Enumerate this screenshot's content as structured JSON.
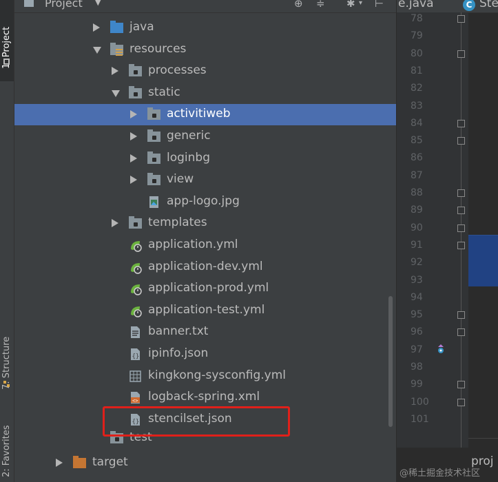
{
  "sidebar": {
    "project_tab": "1: Project",
    "structure_tab": "7: Structure",
    "favorites_tab": "2: Favorites"
  },
  "toolbar": {
    "title": "Project",
    "caret": "▼"
  },
  "tree": [
    {
      "label": "java",
      "indent": 1,
      "expand": "right",
      "icon": "folder-blue-icon"
    },
    {
      "label": "resources",
      "indent": 1,
      "expand": "down",
      "icon": "resources-folder-icon"
    },
    {
      "label": "processes",
      "indent": 2,
      "expand": "right",
      "icon": "folder-icon"
    },
    {
      "label": "static",
      "indent": 2,
      "expand": "down",
      "icon": "folder-icon"
    },
    {
      "label": "activitiweb",
      "indent": 3,
      "expand": "right",
      "icon": "folder-icon",
      "selected": true
    },
    {
      "label": "generic",
      "indent": 3,
      "expand": "right",
      "icon": "folder-icon"
    },
    {
      "label": "loginbg",
      "indent": 3,
      "expand": "right",
      "icon": "folder-icon"
    },
    {
      "label": "view",
      "indent": 3,
      "expand": "right",
      "icon": "folder-icon"
    },
    {
      "label": "app-logo.jpg",
      "indent": 3,
      "expand": "none",
      "icon": "image-file-icon"
    },
    {
      "label": "templates",
      "indent": 2,
      "expand": "right",
      "icon": "folder-icon"
    },
    {
      "label": "application.yml",
      "indent": 2,
      "expand": "none",
      "icon": "spring-config-icon"
    },
    {
      "label": "application-dev.yml",
      "indent": 2,
      "expand": "none",
      "icon": "spring-config-icon"
    },
    {
      "label": "application-prod.yml",
      "indent": 2,
      "expand": "none",
      "icon": "spring-config-icon"
    },
    {
      "label": "application-test.yml",
      "indent": 2,
      "expand": "none",
      "icon": "spring-config-icon"
    },
    {
      "label": "banner.txt",
      "indent": 2,
      "expand": "none",
      "icon": "text-file-icon"
    },
    {
      "label": "ipinfo.json",
      "indent": 2,
      "expand": "none",
      "icon": "json-file-icon"
    },
    {
      "label": "kingkong-sysconfig.yml",
      "indent": 2,
      "expand": "none",
      "icon": "table-file-icon"
    },
    {
      "label": "logback-spring.xml",
      "indent": 2,
      "expand": "none",
      "icon": "xml-file-icon"
    },
    {
      "label": "stencilset.json",
      "indent": 2,
      "expand": "none",
      "icon": "json-file-icon",
      "highlighted": true
    },
    {
      "label": "test",
      "indent": 1,
      "expand": "none",
      "icon": "folder-icon"
    },
    {
      "label": "target",
      "indent": 0,
      "expand": "right",
      "icon": "folder-orange-icon"
    }
  ],
  "editor": {
    "tab1": "e.java",
    "tab2_icon": "C",
    "tab2": "Ste",
    "line_numbers": [
      "78",
      "79",
      "80",
      "81",
      "82",
      "83",
      "84",
      "85",
      "86",
      "87",
      "88",
      "89",
      "90",
      "91",
      "92",
      "93",
      "94",
      "95",
      "96",
      "97",
      "98",
      "99",
      "100",
      "101"
    ],
    "bottom_text": "proj"
  },
  "watermark": "@稀土掘金技术社区",
  "colors": {
    "selection": "#4b6eaf",
    "highlight_box": "#e0201a",
    "panel_bg": "#3c3f41",
    "editor_bg": "#2b2b2b"
  }
}
